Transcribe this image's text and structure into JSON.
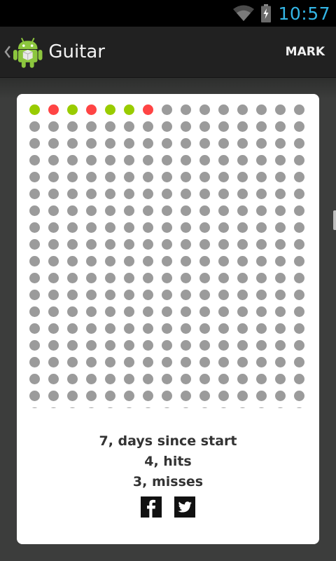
{
  "status_bar": {
    "time": "10:57",
    "icons": [
      "wifi-icon",
      "battery-charging-icon"
    ],
    "accent_color": "#33b5e5"
  },
  "action_bar": {
    "title": "Guitar",
    "action_label": "MARK",
    "icons": [
      "chevron-left-icon",
      "android-app-icon"
    ]
  },
  "calendar_grid": {
    "columns": 15,
    "marked": [
      "hit",
      "miss",
      "hit",
      "miss",
      "hit",
      "hit",
      "miss"
    ],
    "colors": {
      "hit": "#99cc00",
      "miss": "#ff4444",
      "empty": "#9b9b9b"
    }
  },
  "stats": {
    "days_since_start": "7, days since start",
    "hits": "4, hits",
    "misses": "3, misses"
  },
  "share": {
    "icons": [
      "facebook-icon",
      "twitter-icon"
    ]
  }
}
